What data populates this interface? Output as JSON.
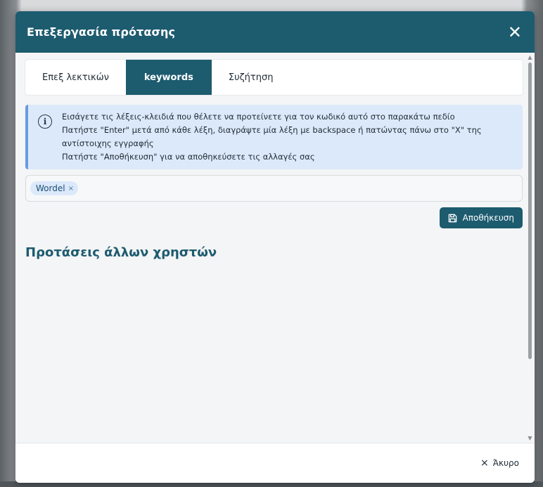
{
  "modal": {
    "title": "Επεξεργασία πρότασης",
    "close_icon": "close-icon"
  },
  "tabs": [
    {
      "label": "Επεξ λεκτικών",
      "active": false
    },
    {
      "label": "keywords",
      "active": true
    },
    {
      "label": "Συζήτηση",
      "active": false
    }
  ],
  "info": {
    "icon": "info-icon",
    "lines": [
      "Εισάγετε τις λέξεις-κλειδιά που θέλετε να προτείνετε για τον κωδικό αυτό στο παρακάτω πεδίο",
      "Πατήστε \"Enter\" μετά από κάθε λέξη, διαγράψτε μία λέξη με backspace ή πατώντας πάνω στο \"X\" της αντίστοιχης εγγραφής",
      "Πατήστε \"Αποθήκευση\" για να αποθηκεύσετε τις αλλαγές σας"
    ]
  },
  "keywords": {
    "tags": [
      {
        "label": "Wordel",
        "remove": "×"
      }
    ]
  },
  "save_button": {
    "label": "Αποθήκευση",
    "icon": "save-icon"
  },
  "other_users": {
    "title": "Προτάσεις άλλων χρηστών"
  },
  "footer": {
    "cancel_label": "Άκυρο",
    "cancel_icon": "×"
  },
  "colors": {
    "primary": "#1d5b6f",
    "info_bg": "#dbe9fa",
    "info_border": "#6a9be0"
  }
}
